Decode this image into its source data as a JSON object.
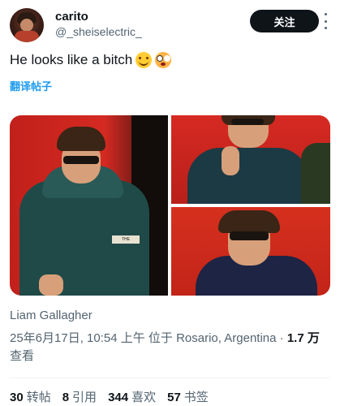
{
  "author": {
    "display_name": "carito",
    "handle": "@_sheiselectric_"
  },
  "follow_label": "关注",
  "tweet": {
    "text": "He looks like a bitch",
    "emojis": [
      "smiling-face-icon",
      "flushed-face-icon"
    ],
    "translate_label": "翻译帖子"
  },
  "media": {
    "count": 3,
    "caption": "Liam Gallagher",
    "jacket_badge": "THE RAINBOW"
  },
  "meta": {
    "date_location": "25年6月17日, 10:54 上午 位于 Rosario, Argentina · ",
    "views_number": "1.7 万",
    "views_label": " 查看"
  },
  "stats": [
    {
      "count": "30",
      "label": "转帖"
    },
    {
      "count": "8",
      "label": "引用"
    },
    {
      "count": "344",
      "label": "喜欢"
    },
    {
      "count": "57",
      "label": "书签"
    }
  ],
  "colors": {
    "link": "#1d9bf0",
    "muted": "#536471",
    "text": "#0f1419",
    "follow_bg": "#0f1419"
  }
}
